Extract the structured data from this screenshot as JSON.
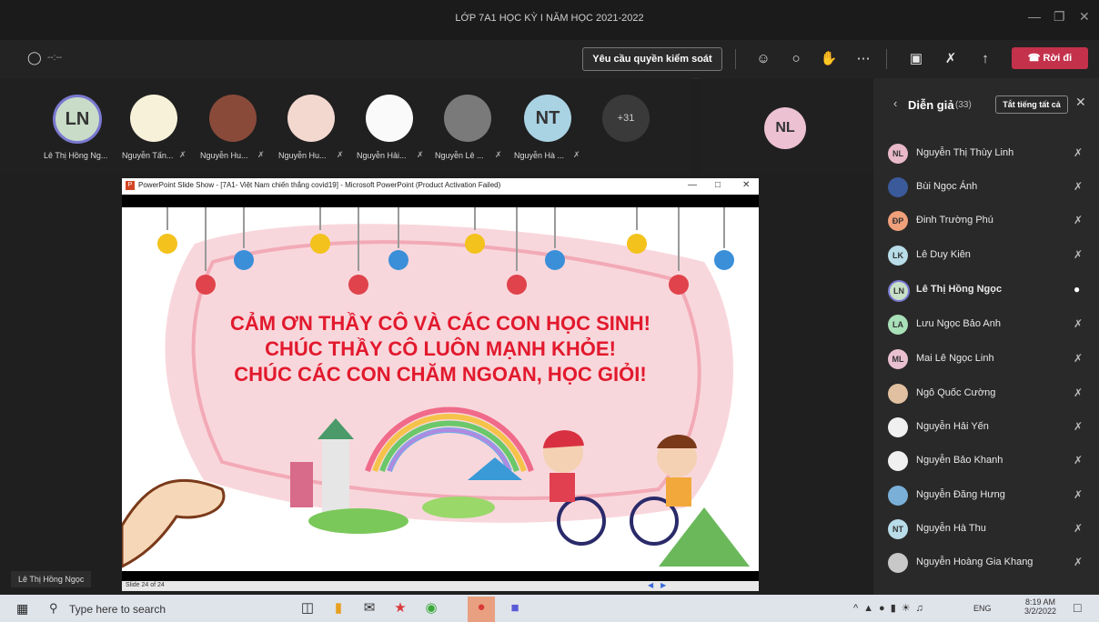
{
  "window": {
    "title": "LỚP 7A1 HỌC KỲ I NĂM HỌC 2021-2022"
  },
  "toolbar": {
    "timer": "--:--",
    "request_control": "Yêu cầu quyền kiểm soát",
    "leave": "Rời đi"
  },
  "gallery": {
    "participants": [
      {
        "initials": "LN",
        "name": "Lê Thị Hồng Ng..."
      },
      {
        "initials": "",
        "name": "Nguyễn Tấn..."
      },
      {
        "initials": "",
        "name": "Nguyễn Hu..."
      },
      {
        "initials": "",
        "name": "Nguyễn Hu..."
      },
      {
        "initials": "",
        "name": "Nguyễn Hải..."
      },
      {
        "initials": "",
        "name": "Nguyễn Lê ..."
      },
      {
        "initials": "NT",
        "name": "Nguyễn Hà ..."
      }
    ],
    "more": "+31",
    "extra_initials": "NL"
  },
  "slide_window": {
    "title": "PowerPoint Slide Show - [7A1- Việt Nam chiến thắng covid19] - Microsoft PowerPoint (Product Activation Failed)",
    "status": "Slide 24 of 24",
    "lines": [
      "CẢM ƠN THẦY CÔ VÀ CÁC CON HỌC SINH!",
      "CHÚC THẦY CÔ LUÔN MẠNH KHỎE!",
      "CHÚC CÁC CON CHĂM NGOAN, HỌC GIỎI!"
    ]
  },
  "presenter_label": "Lê Thị Hồng Ngọc",
  "panel": {
    "title": "Diễn giả",
    "count": "(33)",
    "mute_all": "Tắt tiếng tất cả",
    "people": [
      {
        "initials": "NL",
        "name": "Nguyễn Thị Thùy Linh",
        "color": "#e8b9c8"
      },
      {
        "initials": "",
        "name": "Bùi Ngọc Ánh",
        "color": "#3a5a9a"
      },
      {
        "initials": "ĐP",
        "name": "Đinh Trường Phú",
        "color": "#f0a07a"
      },
      {
        "initials": "LK",
        "name": "Lê Duy Kiên",
        "color": "#b8dce8"
      },
      {
        "initials": "LN",
        "name": "Lê Thị Hồng Ngọc",
        "color": "#c8e0c8"
      },
      {
        "initials": "LA",
        "name": "Lưu Ngọc Bảo Anh",
        "color": "#a8e0b8"
      },
      {
        "initials": "ML",
        "name": "Mai Lê Ngọc Linh",
        "color": "#e8c0d0"
      },
      {
        "initials": "",
        "name": "Ngô Quốc Cường",
        "color": "#e0c0a0"
      },
      {
        "initials": "",
        "name": "Nguyễn Hải Yến",
        "color": "#f0f0f0"
      },
      {
        "initials": "",
        "name": "Nguyễn Bảo Khanh",
        "color": "#f0f0f0"
      },
      {
        "initials": "",
        "name": "Nguyễn Đăng Hưng",
        "color": "#7ab0d8"
      },
      {
        "initials": "NT",
        "name": "Nguyễn Hà Thu",
        "color": "#b8dce8"
      },
      {
        "initials": "",
        "name": "Nguyễn Hoàng Gia Khang",
        "color": "#c8c8c8"
      }
    ]
  },
  "taskbar": {
    "search_placeholder": "Type here to search",
    "lang": "ENG",
    "time": "8:19 AM",
    "date": "3/2/2022"
  }
}
